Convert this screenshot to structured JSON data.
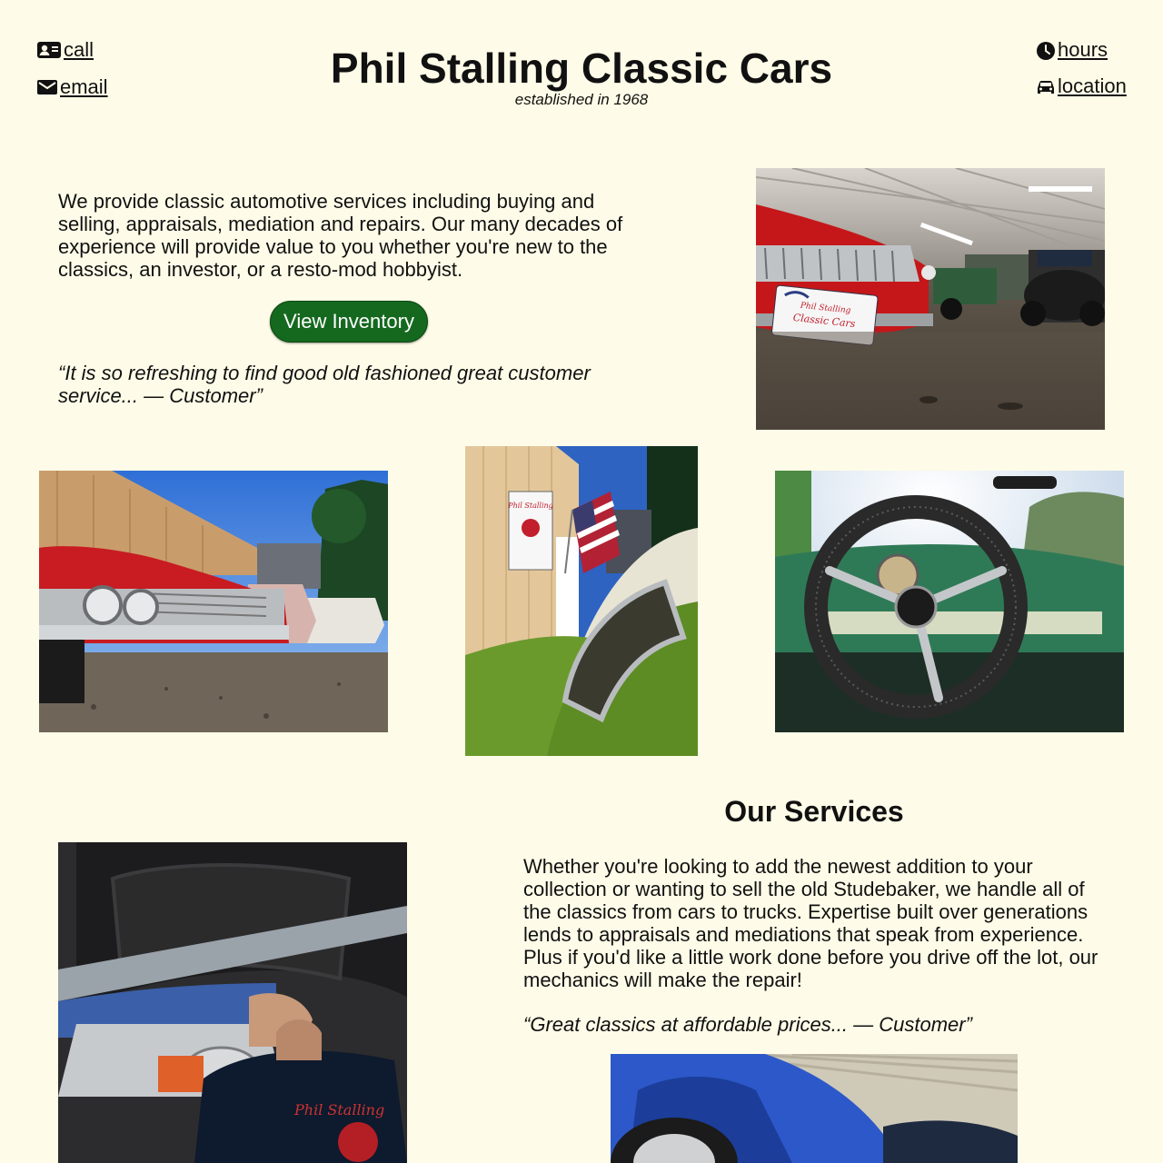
{
  "header": {
    "title": "Phil Stalling Classic Cars",
    "tagline": "established in 1968",
    "nav": {
      "call": "call",
      "email": "email",
      "hours": "hours",
      "location": "location"
    }
  },
  "intro": {
    "text": "We provide classic automotive services including buying and selling, appraisals, mediation and repairs. Our many decades of experience will provide value to you whether you're new to the classics, an investor, or a resto-mod hobbyist.",
    "button_label": "View Inventory",
    "quote": "“It is so refreshing to find good old fashioned great customer service... — Customer”"
  },
  "services": {
    "heading": "Our Services",
    "text": "Whether you're looking to add the newest addition to your collection or wanting to sell the old Studebaker, we handle all of the classics from cars to trucks. Expertise built over generations lends to appraisals and mediations that speak from experience. Plus if you'd like a little work done before you drive off the lot, our mechanics will make the repair!",
    "quote": "“Great classics at affordable prices... — Customer”"
  },
  "showroom_sign": {
    "line1": "Phil Stalling",
    "line2": "Classic Cars"
  },
  "colors": {
    "background": "#fefce8",
    "button": "#15691f",
    "text": "#111111"
  }
}
